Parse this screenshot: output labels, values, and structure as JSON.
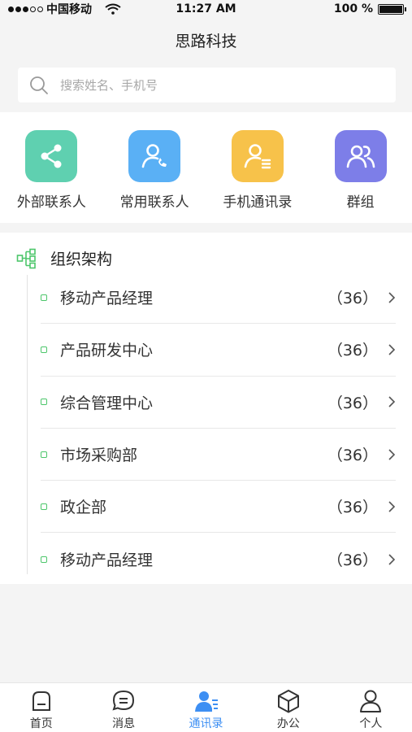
{
  "status_bar": {
    "carrier": "中国移动",
    "time": "11:27 AM",
    "battery_text": "100 %",
    "battery_level": 1.0
  },
  "header": {
    "title": "思路科技"
  },
  "search": {
    "placeholder": "搜索姓名、手机号",
    "value": ""
  },
  "quick_entries": [
    {
      "label": "外部联系人",
      "icon": "share-network-icon",
      "color": "#5fd0b0"
    },
    {
      "label": "常用联系人",
      "icon": "contact-phone-icon",
      "color": "#5ab0f5"
    },
    {
      "label": "手机通讯录",
      "icon": "contact-list-icon",
      "color": "#f7c24a"
    },
    {
      "label": "群组",
      "icon": "group-icon",
      "color": "#7d7ee8"
    }
  ],
  "org": {
    "title": "组织架构",
    "icon": "org-tree-icon",
    "departments": [
      {
        "name": "移动产品经理",
        "count": "（36）"
      },
      {
        "name": "产品研发中心",
        "count": "（36）"
      },
      {
        "name": "综合管理中心",
        "count": "（36）"
      },
      {
        "name": "市场采购部",
        "count": "（36）"
      },
      {
        "name": "政企部",
        "count": "（36）"
      },
      {
        "name": "移动产品经理",
        "count": "（36）"
      }
    ]
  },
  "tab_bar": {
    "active": "通讯录",
    "active_color": "#3d8ff3",
    "tabs": [
      {
        "label": "首页",
        "icon": "home-icon"
      },
      {
        "label": "消息",
        "icon": "message-icon"
      },
      {
        "label": "通讯录",
        "icon": "contacts-icon"
      },
      {
        "label": "办公",
        "icon": "cube-icon"
      },
      {
        "label": "个人",
        "icon": "person-icon"
      }
    ]
  }
}
